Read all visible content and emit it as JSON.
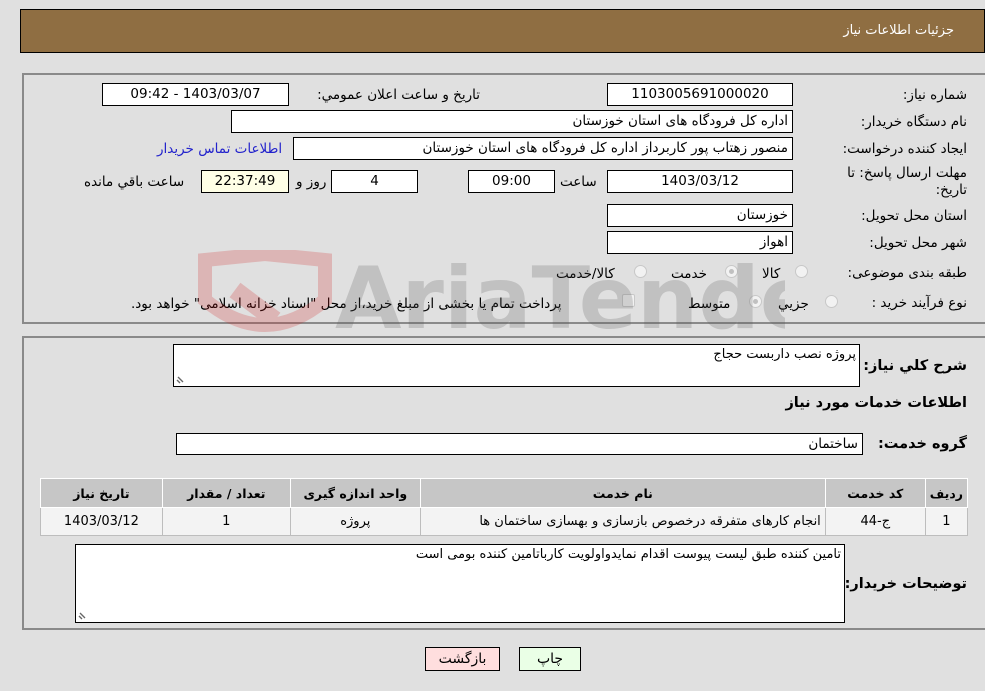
{
  "header": {
    "title": "جزئیات اطلاعات نیاز"
  },
  "details": {
    "need_number": {
      "label": "شماره نیاز:",
      "value": "1103005691000020"
    },
    "announce_datetime": {
      "label": "تاريخ و ساعت اعلان عمومي:",
      "value": "1403/03/07 - 09:42"
    },
    "buyer_org": {
      "label": "نام دستگاه خریدار:",
      "value": "اداره کل فرودگاه های استان خوزستان"
    },
    "requester": {
      "label": "ایجاد کننده درخواست:",
      "value": "منصور زهتاب پور کاربرداز اداره کل فرودگاه های استان خوزستان"
    },
    "buyer_contact_link": "اطلاعات تماس خریدار",
    "deadline": {
      "label": "مهلت ارسال پاسخ: تا تاریخ:",
      "date": "1403/03/12",
      "time_label": "ساعت",
      "time": "09:00",
      "days": "4",
      "days_label": "روز و",
      "remaining": "22:37:49",
      "remaining_label": "ساعت باقي مانده"
    },
    "delivery_province": {
      "label": "استان محل تحویل:",
      "value": "خوزستان"
    },
    "delivery_city": {
      "label": "شهر محل تحویل:",
      "value": "اهواز"
    },
    "category": {
      "label": "طبقه بندی موضوعی:",
      "options": [
        "کالا",
        "خدمت",
        "کالا/خدمت"
      ],
      "selected": "خدمت"
    },
    "purchase_process": {
      "label": "نوع فرآیند خرید :",
      "options": [
        "جزيي",
        "متوسط"
      ],
      "selected": "متوسط",
      "treasury_note": "پرداخت تمام یا بخشی از مبلغ خرید،از محل \"اسناد خزانه اسلامی\" خواهد بود."
    }
  },
  "summary": {
    "label": "شرح کلي نیاز:",
    "value": "پروژه نصب داربست حجاج",
    "services_title": "اطلاعات خدمات مورد نیاز",
    "service_group": {
      "label": "گروه خدمت:",
      "value": "ساختمان"
    }
  },
  "table": {
    "headers": [
      "ردیف",
      "کد خدمت",
      "نام خدمت",
      "واحد اندازه گیری",
      "تعداد / مقدار",
      "تاریخ نیاز"
    ],
    "rows": [
      [
        "1",
        "ج-44",
        "انجام کارهای متفرقه درخصوص بازسازی و بهسازی ساختمان ها",
        "پروژه",
        "1",
        "1403/03/12"
      ]
    ]
  },
  "buyer_notes": {
    "label": "توضیحات خریدار:",
    "value": "تامین کننده طبق لیست پیوست اقدام نمایدواولویت کارباتامین کننده بومی است"
  },
  "buttons": {
    "print": "چاپ",
    "back": "بازگشت"
  },
  "watermark": {
    "text": "AriaTender.neT"
  }
}
